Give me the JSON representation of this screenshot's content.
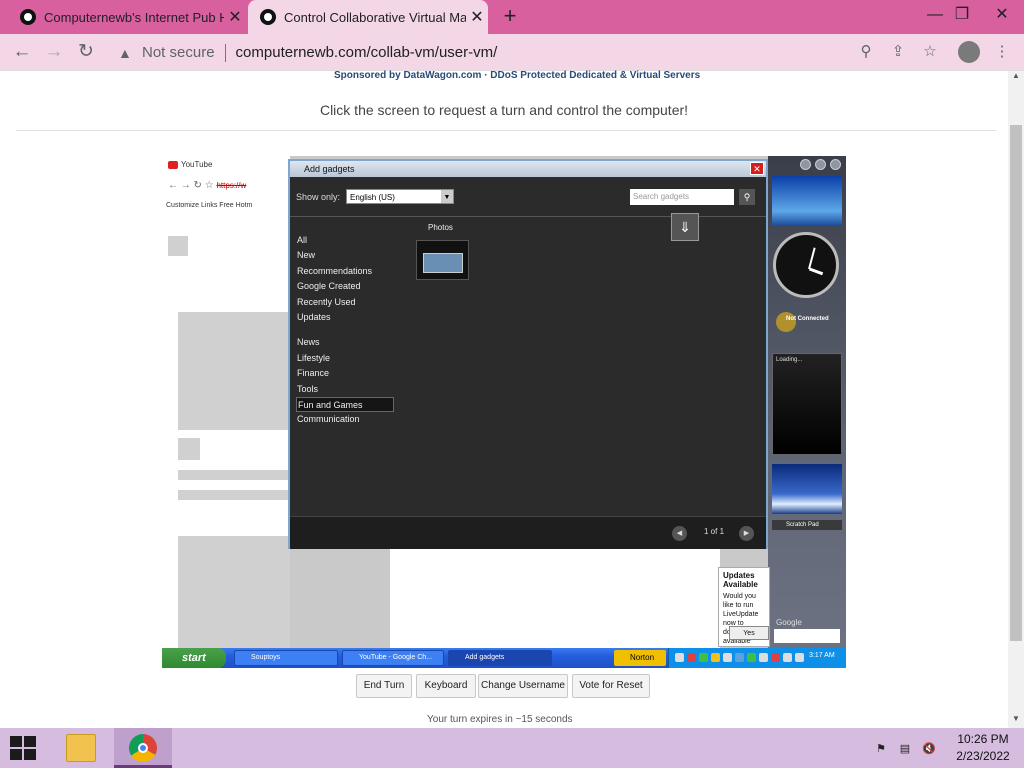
{
  "tabs": [
    {
      "title": "Computernewb's Internet Pub H",
      "close": "✕"
    },
    {
      "title": "Control Collaborative Virtual Ma",
      "close": "✕"
    }
  ],
  "newtab": "+",
  "window_controls": {
    "minimize": "—",
    "restore": "❐",
    "close": "✕"
  },
  "address": {
    "security": "Not secure",
    "url": "computernewb.com/collab-vm/user-vm/"
  },
  "page": {
    "sponsor": "Sponsored by DataWagon.com · DDoS Protected Dedicated & Virtual Servers",
    "instruction": "Click the screen to request a turn and control the computer!",
    "buttons": [
      "End Turn",
      "Keyboard",
      "Change Username",
      "Vote for Reset"
    ],
    "expire": "Your turn expires in ~15 seconds"
  },
  "vm": {
    "browser_tab": "YouTube",
    "browser_url": "https://w",
    "bookmarks": "Customize Links    Free Hotm",
    "gadgets": {
      "title": "Add gadgets",
      "show_only_label": "Show only:",
      "language": "English (US)",
      "search_placeholder": "Search gadgets",
      "categories": [
        "All",
        "New",
        "Recommendations",
        "Google Created",
        "Recently Used",
        "Updates",
        "",
        "News",
        "Lifestyle",
        "Finance",
        "Tools",
        "Fun and Games",
        "Communication"
      ],
      "selected_category": "Fun and Games",
      "section": "Photos",
      "pager": "1 of 1"
    },
    "sidebar": {
      "not_connected": "Not Connected",
      "loading": "Loading...",
      "scratch_pad": "Scratch Pad",
      "google": "Google"
    },
    "updates": {
      "title": "Updates Available",
      "body": "Would you like to run LiveUpdate now to download the available updates?",
      "yes": "Yes"
    },
    "taskbar": {
      "start": "start",
      "items": [
        "Souptoys",
        "YouTube - Google Ch...",
        "Add gadgets"
      ],
      "norton": "Norton",
      "time": "3:17 AM"
    }
  },
  "windows_taskbar": {
    "time": "10:26 PM",
    "date": "2/23/2022"
  }
}
